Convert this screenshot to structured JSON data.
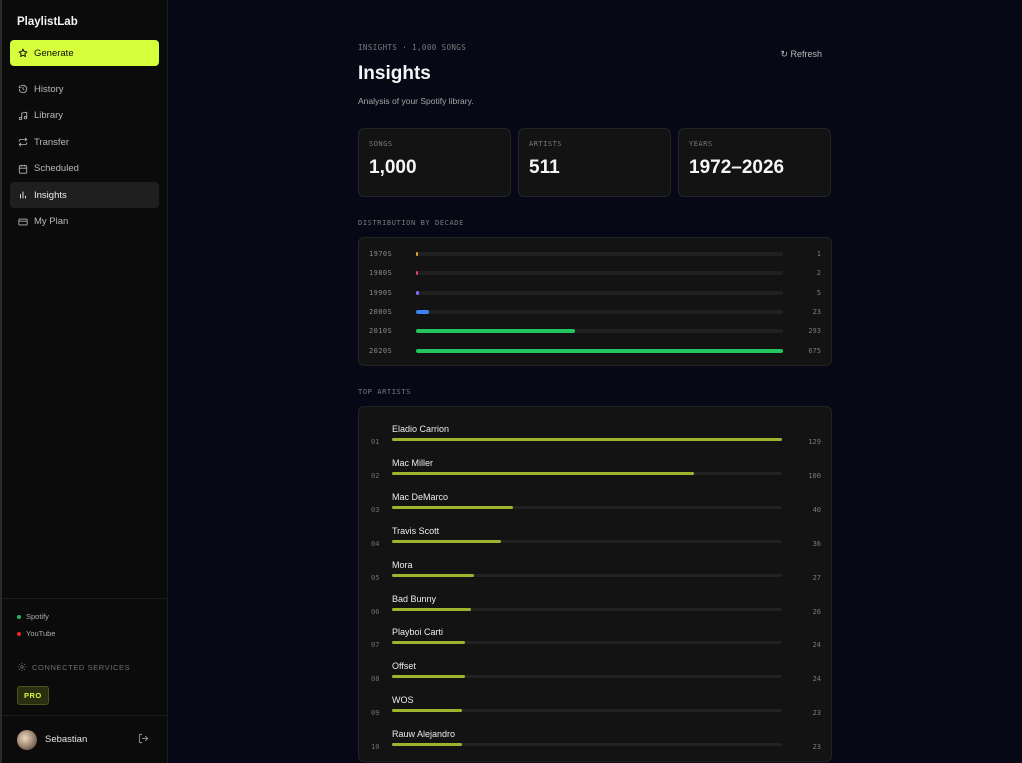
{
  "app": {
    "brand": "PlaylistLab"
  },
  "sidebar": {
    "generate_label": "Generate",
    "items": [
      {
        "label": "History",
        "icon": "history-icon"
      },
      {
        "label": "Library",
        "icon": "music-note-icon"
      },
      {
        "label": "Transfer",
        "icon": "transfer-icon"
      },
      {
        "label": "Scheduled",
        "icon": "calendar-icon"
      },
      {
        "label": "Insights",
        "icon": "bar-chart-icon",
        "active": true
      },
      {
        "label": "My Plan",
        "icon": "credit-card-icon"
      }
    ],
    "services": [
      {
        "label": "Spotify",
        "color": "#1db954"
      },
      {
        "label": "YouTube",
        "color": "#e32b2b"
      }
    ],
    "connected_label": "CONNECTED SERVICES",
    "plan_badge": "PRO",
    "user_name": "Sebastian"
  },
  "header": {
    "eyebrow": "INSIGHTS · 1,000 SONGS",
    "refresh_label": "↻ Refresh",
    "title": "Insights",
    "subtitle": "Analysis of your Spotify library."
  },
  "stats": [
    {
      "label": "SONGS",
      "value": "1,000"
    },
    {
      "label": "ARTISTS",
      "value": "511"
    },
    {
      "label": "YEARS",
      "value": "1972–2026"
    }
  ],
  "decades": {
    "label": "DISTRIBUTION BY DECADE",
    "rows": [
      {
        "label": "1970S",
        "count": 1,
        "color": "#e3a33a"
      },
      {
        "label": "1980S",
        "count": 2,
        "color": "#e0436a"
      },
      {
        "label": "1990S",
        "count": 5,
        "color": "#7b6cf0"
      },
      {
        "label": "2000S",
        "count": 23,
        "color": "#3b82f6"
      },
      {
        "label": "2010S",
        "count": 293,
        "color": "#22c55e"
      },
      {
        "label": "2020S",
        "count": 675,
        "color": "#22c55e"
      }
    ]
  },
  "artists": {
    "label": "TOP ARTISTS",
    "rows": [
      {
        "rank": "01",
        "name": "Eladio Carrion",
        "count": 129
      },
      {
        "rank": "02",
        "name": "Mac Miller",
        "count": 100
      },
      {
        "rank": "03",
        "name": "Mac DeMarco",
        "count": 40
      },
      {
        "rank": "04",
        "name": "Travis Scott",
        "count": 36
      },
      {
        "rank": "05",
        "name": "Mora",
        "count": 27
      },
      {
        "rank": "06",
        "name": "Bad Bunny",
        "count": 26
      },
      {
        "rank": "07",
        "name": "Playboi Carti",
        "count": 24
      },
      {
        "rank": "08",
        "name": "Offset",
        "count": 24
      },
      {
        "rank": "09",
        "name": "WOS",
        "count": 23
      },
      {
        "rank": "10",
        "name": "Rauw Alejandro",
        "count": 23
      }
    ]
  }
}
